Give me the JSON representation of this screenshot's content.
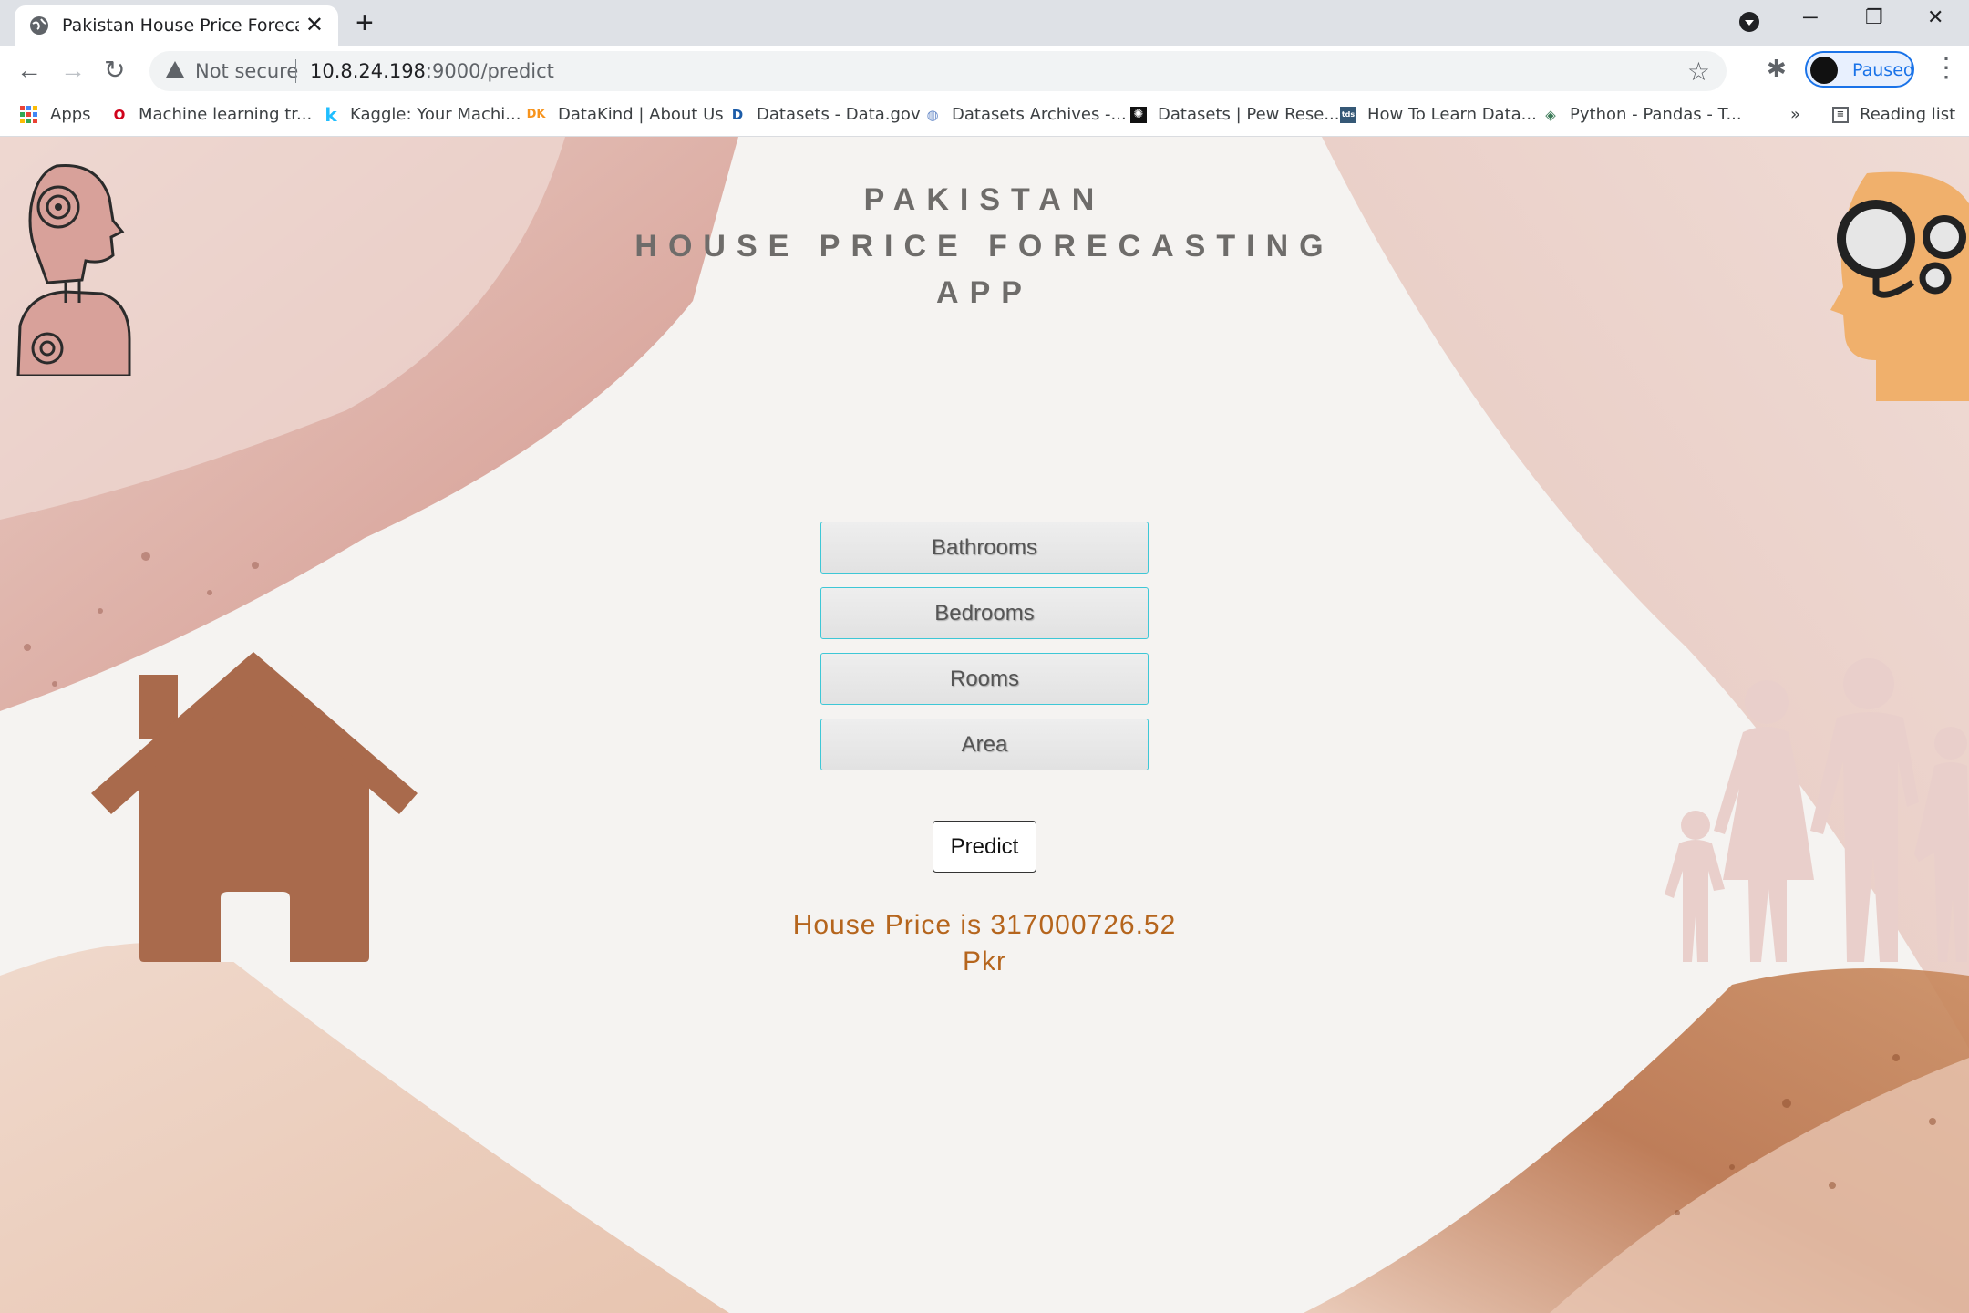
{
  "browser": {
    "tab_title": "Pakistan House Price Forecasting",
    "address": {
      "security": "Not secure",
      "host": "10.8.24.198",
      "path": ":9000/predict"
    },
    "profile_label": "Paused",
    "bookmarks": [
      {
        "label": "Apps",
        "icon": "apps-grid-icon"
      },
      {
        "label": "Machine learning tr...",
        "icon": "opera-icon"
      },
      {
        "label": "Kaggle: Your Machi...",
        "icon": "kaggle-icon"
      },
      {
        "label": "DataKind | About Us",
        "icon": "datakind-icon"
      },
      {
        "label": "Datasets - Data.gov",
        "icon": "datagov-icon"
      },
      {
        "label": "Datasets Archives -...",
        "icon": "globe-icon"
      },
      {
        "label": "Datasets | Pew Rese...",
        "icon": "pew-icon"
      },
      {
        "label": "How To Learn Data...",
        "icon": "tds-icon"
      },
      {
        "label": "Python - Pandas - T...",
        "icon": "tutorialspoint-icon"
      }
    ],
    "bookmarks_overflow": "»",
    "reading_list": "Reading list"
  },
  "page": {
    "title_lines": [
      "PAKISTAN",
      "HOUSE PRICE FORECASTING",
      "APP"
    ],
    "inputs": [
      {
        "placeholder": "Bathrooms"
      },
      {
        "placeholder": "Bedrooms"
      },
      {
        "placeholder": "Rooms"
      },
      {
        "placeholder": "Area"
      }
    ],
    "predict_label": "Predict",
    "result_line1": "House Price is 317000726.52",
    "result_line2": "Pkr"
  },
  "colors": {
    "accent_result": "#b5651d",
    "house": "#a96a4c",
    "input_border": "#3ec7d6",
    "head_orange": "#f0b06c",
    "family_pink": "#e9cfcb"
  }
}
